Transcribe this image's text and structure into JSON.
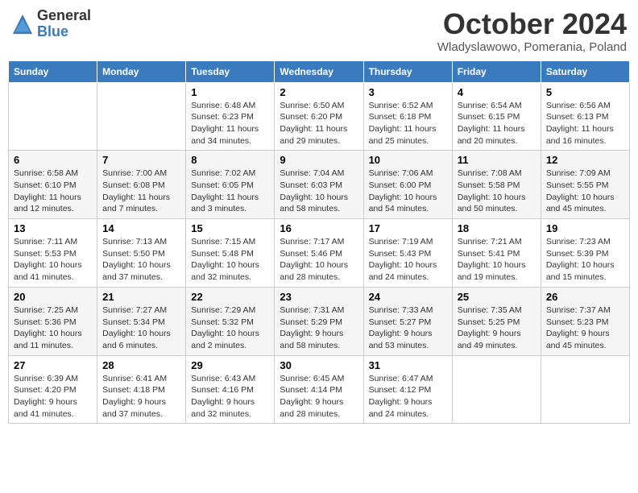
{
  "header": {
    "logo_general": "General",
    "logo_blue": "Blue",
    "month_title": "October 2024",
    "location": "Wladyslawowo, Pomerania, Poland"
  },
  "weekdays": [
    "Sunday",
    "Monday",
    "Tuesday",
    "Wednesday",
    "Thursday",
    "Friday",
    "Saturday"
  ],
  "weeks": [
    [
      {
        "day": "",
        "sunrise": "",
        "sunset": "",
        "daylight": ""
      },
      {
        "day": "",
        "sunrise": "",
        "sunset": "",
        "daylight": ""
      },
      {
        "day": "1",
        "sunrise": "Sunrise: 6:48 AM",
        "sunset": "Sunset: 6:23 PM",
        "daylight": "Daylight: 11 hours and 34 minutes."
      },
      {
        "day": "2",
        "sunrise": "Sunrise: 6:50 AM",
        "sunset": "Sunset: 6:20 PM",
        "daylight": "Daylight: 11 hours and 29 minutes."
      },
      {
        "day": "3",
        "sunrise": "Sunrise: 6:52 AM",
        "sunset": "Sunset: 6:18 PM",
        "daylight": "Daylight: 11 hours and 25 minutes."
      },
      {
        "day": "4",
        "sunrise": "Sunrise: 6:54 AM",
        "sunset": "Sunset: 6:15 PM",
        "daylight": "Daylight: 11 hours and 20 minutes."
      },
      {
        "day": "5",
        "sunrise": "Sunrise: 6:56 AM",
        "sunset": "Sunset: 6:13 PM",
        "daylight": "Daylight: 11 hours and 16 minutes."
      }
    ],
    [
      {
        "day": "6",
        "sunrise": "Sunrise: 6:58 AM",
        "sunset": "Sunset: 6:10 PM",
        "daylight": "Daylight: 11 hours and 12 minutes."
      },
      {
        "day": "7",
        "sunrise": "Sunrise: 7:00 AM",
        "sunset": "Sunset: 6:08 PM",
        "daylight": "Daylight: 11 hours and 7 minutes."
      },
      {
        "day": "8",
        "sunrise": "Sunrise: 7:02 AM",
        "sunset": "Sunset: 6:05 PM",
        "daylight": "Daylight: 11 hours and 3 minutes."
      },
      {
        "day": "9",
        "sunrise": "Sunrise: 7:04 AM",
        "sunset": "Sunset: 6:03 PM",
        "daylight": "Daylight: 10 hours and 58 minutes."
      },
      {
        "day": "10",
        "sunrise": "Sunrise: 7:06 AM",
        "sunset": "Sunset: 6:00 PM",
        "daylight": "Daylight: 10 hours and 54 minutes."
      },
      {
        "day": "11",
        "sunrise": "Sunrise: 7:08 AM",
        "sunset": "Sunset: 5:58 PM",
        "daylight": "Daylight: 10 hours and 50 minutes."
      },
      {
        "day": "12",
        "sunrise": "Sunrise: 7:09 AM",
        "sunset": "Sunset: 5:55 PM",
        "daylight": "Daylight: 10 hours and 45 minutes."
      }
    ],
    [
      {
        "day": "13",
        "sunrise": "Sunrise: 7:11 AM",
        "sunset": "Sunset: 5:53 PM",
        "daylight": "Daylight: 10 hours and 41 minutes."
      },
      {
        "day": "14",
        "sunrise": "Sunrise: 7:13 AM",
        "sunset": "Sunset: 5:50 PM",
        "daylight": "Daylight: 10 hours and 37 minutes."
      },
      {
        "day": "15",
        "sunrise": "Sunrise: 7:15 AM",
        "sunset": "Sunset: 5:48 PM",
        "daylight": "Daylight: 10 hours and 32 minutes."
      },
      {
        "day": "16",
        "sunrise": "Sunrise: 7:17 AM",
        "sunset": "Sunset: 5:46 PM",
        "daylight": "Daylight: 10 hours and 28 minutes."
      },
      {
        "day": "17",
        "sunrise": "Sunrise: 7:19 AM",
        "sunset": "Sunset: 5:43 PM",
        "daylight": "Daylight: 10 hours and 24 minutes."
      },
      {
        "day": "18",
        "sunrise": "Sunrise: 7:21 AM",
        "sunset": "Sunset: 5:41 PM",
        "daylight": "Daylight: 10 hours and 19 minutes."
      },
      {
        "day": "19",
        "sunrise": "Sunrise: 7:23 AM",
        "sunset": "Sunset: 5:39 PM",
        "daylight": "Daylight: 10 hours and 15 minutes."
      }
    ],
    [
      {
        "day": "20",
        "sunrise": "Sunrise: 7:25 AM",
        "sunset": "Sunset: 5:36 PM",
        "daylight": "Daylight: 10 hours and 11 minutes."
      },
      {
        "day": "21",
        "sunrise": "Sunrise: 7:27 AM",
        "sunset": "Sunset: 5:34 PM",
        "daylight": "Daylight: 10 hours and 6 minutes."
      },
      {
        "day": "22",
        "sunrise": "Sunrise: 7:29 AM",
        "sunset": "Sunset: 5:32 PM",
        "daylight": "Daylight: 10 hours and 2 minutes."
      },
      {
        "day": "23",
        "sunrise": "Sunrise: 7:31 AM",
        "sunset": "Sunset: 5:29 PM",
        "daylight": "Daylight: 9 hours and 58 minutes."
      },
      {
        "day": "24",
        "sunrise": "Sunrise: 7:33 AM",
        "sunset": "Sunset: 5:27 PM",
        "daylight": "Daylight: 9 hours and 53 minutes."
      },
      {
        "day": "25",
        "sunrise": "Sunrise: 7:35 AM",
        "sunset": "Sunset: 5:25 PM",
        "daylight": "Daylight: 9 hours and 49 minutes."
      },
      {
        "day": "26",
        "sunrise": "Sunrise: 7:37 AM",
        "sunset": "Sunset: 5:23 PM",
        "daylight": "Daylight: 9 hours and 45 minutes."
      }
    ],
    [
      {
        "day": "27",
        "sunrise": "Sunrise: 6:39 AM",
        "sunset": "Sunset: 4:20 PM",
        "daylight": "Daylight: 9 hours and 41 minutes."
      },
      {
        "day": "28",
        "sunrise": "Sunrise: 6:41 AM",
        "sunset": "Sunset: 4:18 PM",
        "daylight": "Daylight: 9 hours and 37 minutes."
      },
      {
        "day": "29",
        "sunrise": "Sunrise: 6:43 AM",
        "sunset": "Sunset: 4:16 PM",
        "daylight": "Daylight: 9 hours and 32 minutes."
      },
      {
        "day": "30",
        "sunrise": "Sunrise: 6:45 AM",
        "sunset": "Sunset: 4:14 PM",
        "daylight": "Daylight: 9 hours and 28 minutes."
      },
      {
        "day": "31",
        "sunrise": "Sunrise: 6:47 AM",
        "sunset": "Sunset: 4:12 PM",
        "daylight": "Daylight: 9 hours and 24 minutes."
      },
      {
        "day": "",
        "sunrise": "",
        "sunset": "",
        "daylight": ""
      },
      {
        "day": "",
        "sunrise": "",
        "sunset": "",
        "daylight": ""
      }
    ]
  ]
}
